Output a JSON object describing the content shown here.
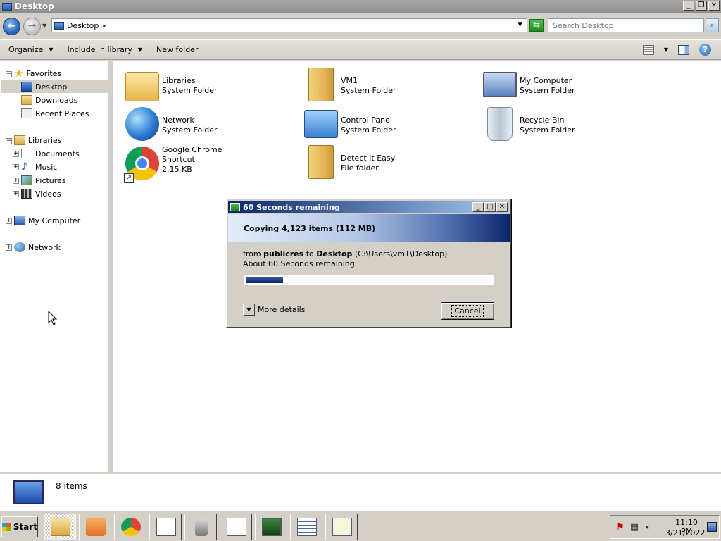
{
  "window": {
    "title": "Desktop",
    "controls": {
      "minimize": "_",
      "maximize": "❐",
      "close": "✕"
    }
  },
  "address": {
    "path": "Desktop",
    "search_placeholder": "Search Desktop"
  },
  "toolbar": {
    "organize": "Organize",
    "include_in_library": "Include in library",
    "new_folder": "New folder"
  },
  "nav": {
    "favorites": "Favorites",
    "desktop": "Desktop",
    "downloads": "Downloads",
    "recent_places": "Recent Places",
    "libraries": "Libraries",
    "documents": "Documents",
    "music": "Music",
    "pictures": "Pictures",
    "videos": "Videos",
    "my_computer": "My Computer",
    "network": "Network"
  },
  "items": [
    {
      "name": "Libraries",
      "type": "System Folder",
      "icon": "libraries-icon"
    },
    {
      "name": "VM1",
      "type": "System Folder",
      "icon": "user-folder-icon"
    },
    {
      "name": "My Computer",
      "type": "System Folder",
      "icon": "computer-icon"
    },
    {
      "name": "Network",
      "type": "System Folder",
      "icon": "network-icon"
    },
    {
      "name": "Control Panel",
      "type": "System Folder",
      "icon": "control-panel-icon"
    },
    {
      "name": "Recycle Bin",
      "type": "System Folder",
      "icon": "recycle-bin-icon"
    },
    {
      "name": "Google Chrome",
      "type": "Shortcut",
      "size": "2.15 KB",
      "icon": "chrome-icon"
    },
    {
      "name": "Detect It Easy",
      "type": "File folder",
      "icon": "folder-icon"
    }
  ],
  "dialog": {
    "title": "60 Seconds remaining",
    "heading": "Copying 4,123 items (112 MB)",
    "from_prefix": "from",
    "source": "publicres",
    "to_word": "to",
    "destination": "Desktop",
    "destination_path": "(C:\\Users\\vm1\\Desktop)",
    "remaining": "About 60 Seconds remaining",
    "progress_percent": 15,
    "more_details": "More details",
    "cancel": "Cancel"
  },
  "status": {
    "item_count": "8 items"
  },
  "taskbar": {
    "start": "Start",
    "apps": [
      "explorer",
      "media-player",
      "chrome",
      "solitaire",
      "chess",
      "wordpad",
      "task-manager",
      "list-app",
      "chart-app"
    ],
    "time": "11:10 PM",
    "date": "3/21/2022"
  }
}
